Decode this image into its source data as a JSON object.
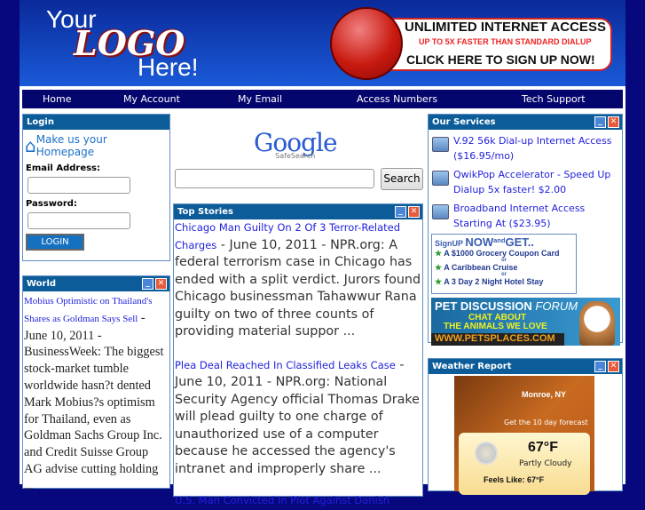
{
  "logo": {
    "line1": "Your",
    "line2": "LOGO",
    "line3": "Here!"
  },
  "banner": {
    "title": "UNLIMITED INTERNET ACCESS",
    "subtitle": "UP TO 5X FASTER THAN STANDARD DIALUP",
    "cta": "CLICK HERE TO SIGN UP NOW!"
  },
  "nav": [
    "Home",
    "My Account",
    "My Email",
    "Access Numbers",
    "Tech Support"
  ],
  "login": {
    "title": "Login",
    "homepage": "Make us your Homepage",
    "email_label": "Email Address:",
    "password_label": "Password:",
    "button": "LOGIN"
  },
  "search": {
    "logo": "Google",
    "sub": "SafeSearch",
    "button": "Search",
    "value": ""
  },
  "top_stories": {
    "title": "Top Stories",
    "items": [
      {
        "headline": "Chicago Man Guilty On 2 Of 3 Terror-Related Charges",
        "body": " - June 10, 2011 - NPR.org: A federal terrorism case in Chicago has ended with a split verdict. Jurors found Chicago businessman Tahawwur Rana guilty on two of three counts of providing material suppor ..."
      },
      {
        "headline": "Plea Deal Reached In Classified Leaks Case",
        "body": " - June 10, 2011 - NPR.org: National Security Agency official Thomas Drake will plead guilty to one charge of unauthorized use of a computer because he accessed the agency's intranet and improperly share ..."
      },
      {
        "headline": "U.S. Man Convicted In Plot Against Danish",
        "body": ""
      }
    ]
  },
  "world": {
    "title": "World",
    "headline": "Mobius Optimistic on Thailand's Shares as Goldman Says Sell",
    "body": " - June 10, 2011 - BusinessWeek: The biggest stock-market tumble worldwide hasn?t dented Mark Mobius?s optimism for Thailand, even as Goldman Sachs Group Inc. and Credit Suisse Group AG advise cutting holding ..."
  },
  "services": {
    "title": "Our Services",
    "items": [
      "V.92 56k Dial-up Internet Access ($16.95/mo)",
      "QwikPop Accelerator - Speed Up Dialup 5x faster! $2.00",
      "Broadband Internet Access Starting At ($23.95)"
    ],
    "promo": {
      "signup": "SignUP",
      "now": "NOW",
      "and": "and",
      "get": "GET..",
      "items": [
        "A $1000 Grocery Coupon Card",
        "A Caribbean Cruise",
        "A 3 Day 2 Night Hotel Stay"
      ],
      "or": "or"
    },
    "pet": {
      "title": "PET DISCUSSION",
      "forum": "FORUM",
      "chat1": "CHAT ABOUT",
      "chat2": "THE ANIMALS WE LOVE",
      "url": "WWW.PETSPLACES.COM"
    }
  },
  "weather": {
    "title": "Weather Report",
    "location": "Monroe, NY",
    "forecast_link": "Get the 10 day forecast",
    "temp": "67°F",
    "condition": "Partly Cloudy",
    "feels": "Feels Like: 67°F"
  }
}
